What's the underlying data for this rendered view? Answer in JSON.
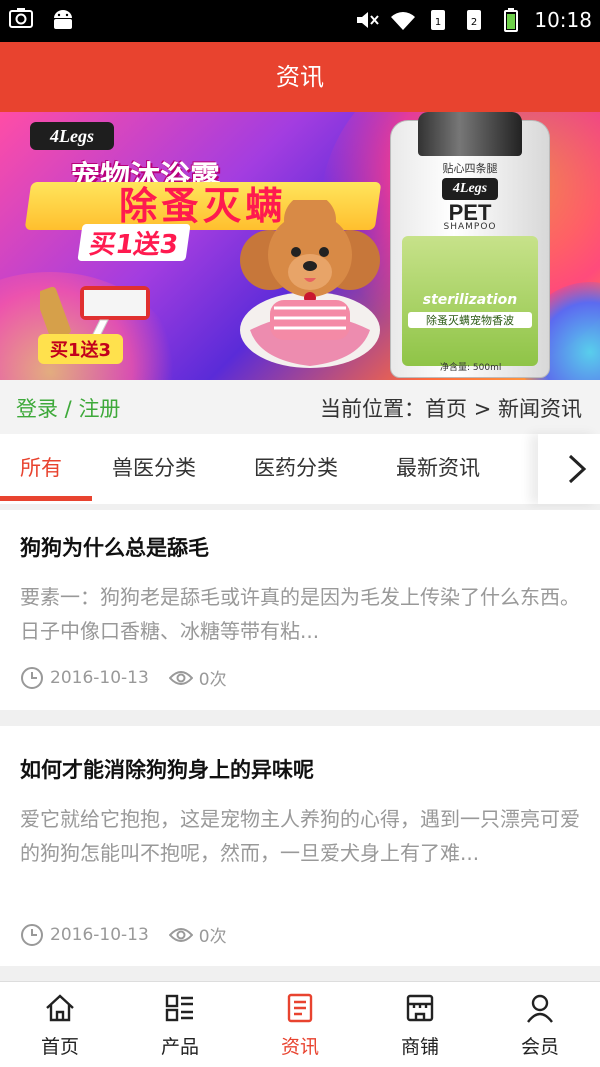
{
  "status_bar": {
    "time": "10:18",
    "icons": [
      "screenshot-icon",
      "android-icon",
      "mute-icon",
      "wifi-icon",
      "sim1-icon",
      "sim2-icon",
      "battery-icon"
    ]
  },
  "header": {
    "title": "资讯"
  },
  "banner": {
    "brand": "4Legs",
    "line1": "宠物沐浴露",
    "line2": "除蚤灭螨",
    "line3": "买1送3",
    "tag": "买1送3",
    "bottle": {
      "top_text": "贴心四条腿",
      "brand": "4Legs",
      "pet": "PET",
      "shampoo": "SHAMPOO",
      "sterilization": "sterilization",
      "cn_label": "除蚤灭螨宠物香波",
      "volume": "净含量: 500ml"
    }
  },
  "breadcrumb": {
    "login": "登录",
    "separator": " / ",
    "register": "注册",
    "position": "当前位置：首页 > 新闻资讯"
  },
  "tabs": [
    {
      "label": "所有",
      "active": true
    },
    {
      "label": "兽医分类",
      "active": false
    },
    {
      "label": "医药分类",
      "active": false
    },
    {
      "label": "最新资讯",
      "active": false
    }
  ],
  "articles": [
    {
      "title": "狗狗为什么总是舔毛",
      "summary": "要素一：狗狗老是舔毛或许真的是因为毛发上传染了什么东西。　　日子中像口香糖、冰糖等带有粘...",
      "date": "2016-10-13",
      "views": "0次"
    },
    {
      "title": "如何才能消除狗狗身上的异味呢",
      "summary": "爱它就给它抱抱，这是宠物主人养狗的心得，遇到一只漂亮可爱的狗狗怎能叫不抱呢，然而，一旦爱犬身上有了难...",
      "date": "2016-10-13",
      "views": "0次"
    }
  ],
  "bottom_nav": [
    {
      "label": "首页",
      "icon": "home-icon",
      "active": false
    },
    {
      "label": "产品",
      "icon": "product-list-icon",
      "active": false
    },
    {
      "label": "资讯",
      "icon": "news-icon",
      "active": true
    },
    {
      "label": "商铺",
      "icon": "shop-icon",
      "active": false
    },
    {
      "label": "会员",
      "icon": "user-icon",
      "active": false
    }
  ],
  "colors": {
    "accent": "#e8432f",
    "login_green": "#3ea93a",
    "muted_text": "#999999"
  }
}
